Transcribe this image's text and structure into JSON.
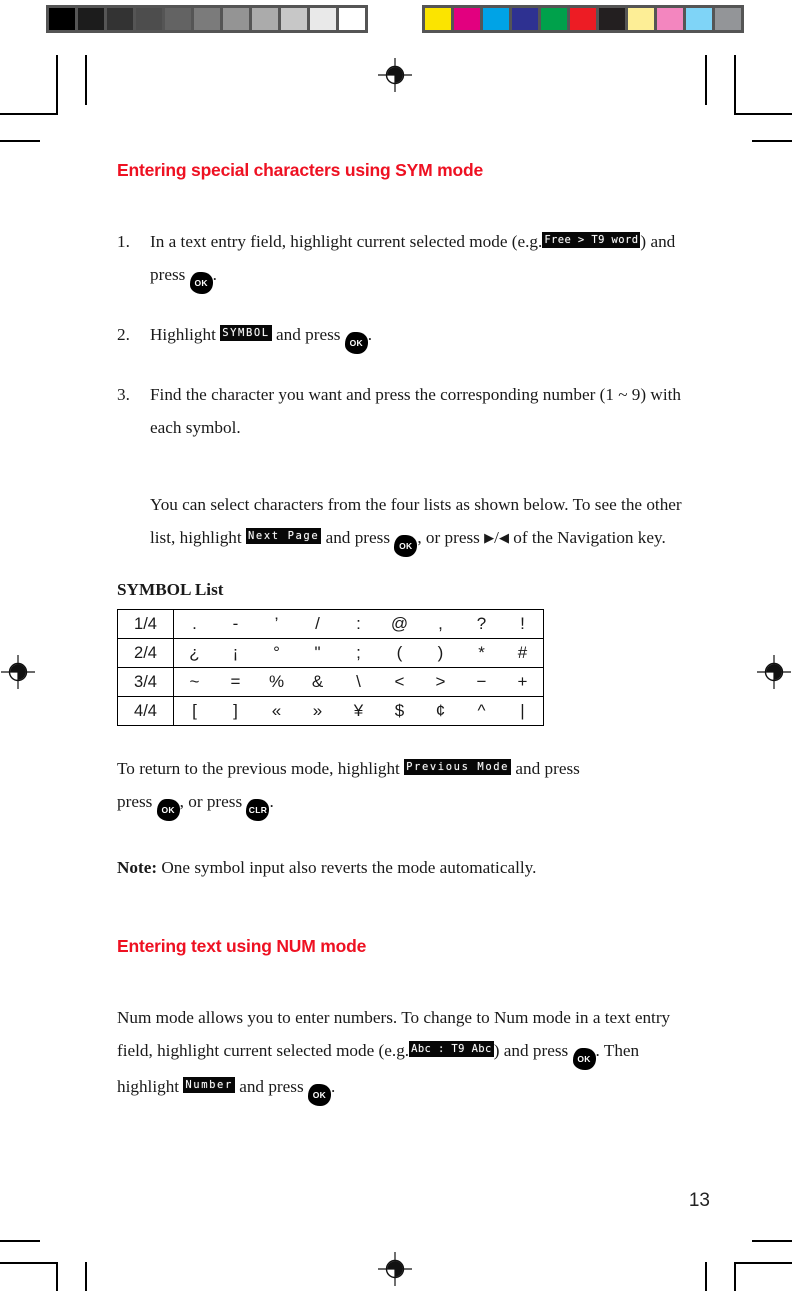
{
  "calibration": {
    "grayscale_label": "grayscale-calibration-bar",
    "grayscale_patches": [
      "#000000",
      "#1c1c1c",
      "#333333",
      "#4d4d4d",
      "#636363",
      "#7b7b7b",
      "#949494",
      "#ababab",
      "#c7c7c7",
      "#e9e9e9",
      "#ffffff"
    ],
    "color_label": "color-calibration-bar",
    "color_patches": [
      "#fbe400",
      "#e2007f",
      "#00a3e6",
      "#2e3191",
      "#00a14b",
      "#ed1c24",
      "#231f20",
      "#fdee96",
      "#f386bf",
      "#7fd4f7",
      "#939598"
    ]
  },
  "colors": {
    "heading_red": "#ee1122",
    "body_black": "#1a1a1a",
    "lcd_background": "#000000",
    "lcd_text": "#ffffff"
  },
  "sections": {
    "sym": {
      "heading": "Entering special characters using SYM mode",
      "steps": [
        {
          "number": "1.",
          "text_before": "In a text entry field, highlight current selected mode (e.g.",
          "lcd": "Free > T9 word",
          "text_middle": ") and press",
          "key": "OK",
          "text_after": "."
        },
        {
          "number": "2.",
          "text_before": "Highlight",
          "lcd": "SYMBOL",
          "text_middle": "and press",
          "key": "OK",
          "text_after": "."
        },
        {
          "number": "3.",
          "text_before": "Find the character you want and press the corresponding number (1 ~ 9) with each symbol.",
          "lcd": "",
          "text_middle": "",
          "key": "",
          "text_after": ""
        }
      ],
      "note_paragraph": {
        "line1": "You can select characters from the four lists as shown below.",
        "line2_before": "To see the other list, highlight",
        "line2_lcd": "Next Page",
        "line2_middle": "and press",
        "line2_key": "OK",
        "line2_after": ", or",
        "line3_before": "press",
        "line3_right_arrow": "▶",
        "line3_slash": "/",
        "line3_left_arrow": "◀",
        "line3_after": "of the Navigation key."
      },
      "return_paragraph": {
        "before": "To return to the previous mode, highlight",
        "lcd": "Previous Mode",
        "middle": "and press",
        "key1": "OK",
        "between": ", or press",
        "key2": "CLR",
        "after": "."
      },
      "note": {
        "label": "Note:",
        "text": "One symbol input also reverts the mode automatically."
      }
    },
    "num": {
      "heading": "Entering text using NUM mode",
      "paragraph": {
        "before": "Num mode allows you to enter numbers. To change to Num mode in a text entry field, highlight current selected mode (e.g.",
        "lcd1": "Abc : T9 Abc",
        "middle1": ") and press",
        "key1": "OK",
        "middle2": ". Then highlight",
        "lcd2": "Number",
        "middle3": "and press",
        "key2": "OK",
        "after": "."
      }
    }
  },
  "symbol_table": {
    "title": "SYMBOL List",
    "rows": [
      {
        "label": "1/4",
        "cells": [
          ".",
          "-",
          "’",
          "/",
          ":",
          "@",
          ",",
          "?",
          "!"
        ]
      },
      {
        "label": "2/4",
        "cells": [
          "¿",
          "¡",
          "°",
          "\"",
          ";",
          "(",
          ")",
          "*",
          "#"
        ]
      },
      {
        "label": "3/4",
        "cells": [
          "~",
          "=",
          "%",
          "&",
          "\\",
          "<",
          ">",
          "−",
          "+"
        ]
      },
      {
        "label": "4/4",
        "cells": [
          "[",
          "]",
          "«",
          "»",
          "¥",
          "$",
          "¢",
          "^",
          "|"
        ]
      }
    ]
  },
  "page_number": "13"
}
